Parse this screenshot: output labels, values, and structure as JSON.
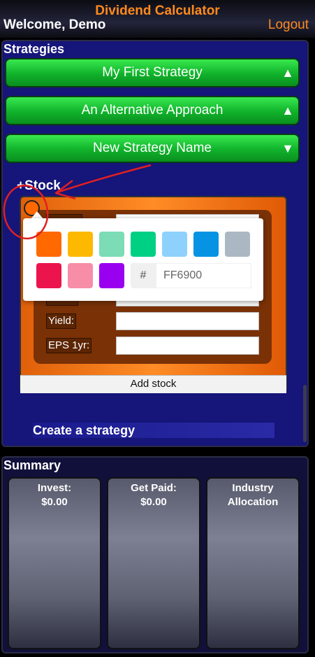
{
  "header": {
    "app_title": "Dividend Calculator",
    "welcome": "Welcome, Demo",
    "logout": "Logout"
  },
  "strategies": {
    "title": "Strategies",
    "items": [
      {
        "label": "My First Strategy",
        "arrow": "▲"
      },
      {
        "label": "An Alternative Approach",
        "arrow": "▲"
      },
      {
        "label": "New Strategy Name",
        "arrow": "▼"
      }
    ],
    "add_stock": "+Stock",
    "create_strategy": "Create a strategy"
  },
  "stock_form": {
    "fields": [
      {
        "label": "Yield:",
        "value": ""
      },
      {
        "label": "EPS 1yr:",
        "value": ""
      }
    ],
    "add_button": "Add stock",
    "card_color": "#ff6900"
  },
  "color_picker": {
    "selected_color": "#ff6900",
    "swatches": [
      "#ff6900",
      "#fcb900",
      "#7bdcb5",
      "#00d084",
      "#8ed1fc",
      "#0693e3",
      "#abb8c3",
      "#eb144c",
      "#f78da7",
      "#9900ef"
    ],
    "hash": "#",
    "hex_value": "FF6900"
  },
  "summary": {
    "title": "Summary",
    "cards": [
      {
        "label": "Invest:",
        "value": "$0.00"
      },
      {
        "label": "Get Paid:",
        "value": "$0.00"
      },
      {
        "label": "Industry",
        "value": "Allocation"
      }
    ]
  },
  "colors": {
    "accent": "#ff8a1f",
    "strategy_green": "#10b22b",
    "panel_blue": "#15157a",
    "annotation_red": "#e02020"
  }
}
